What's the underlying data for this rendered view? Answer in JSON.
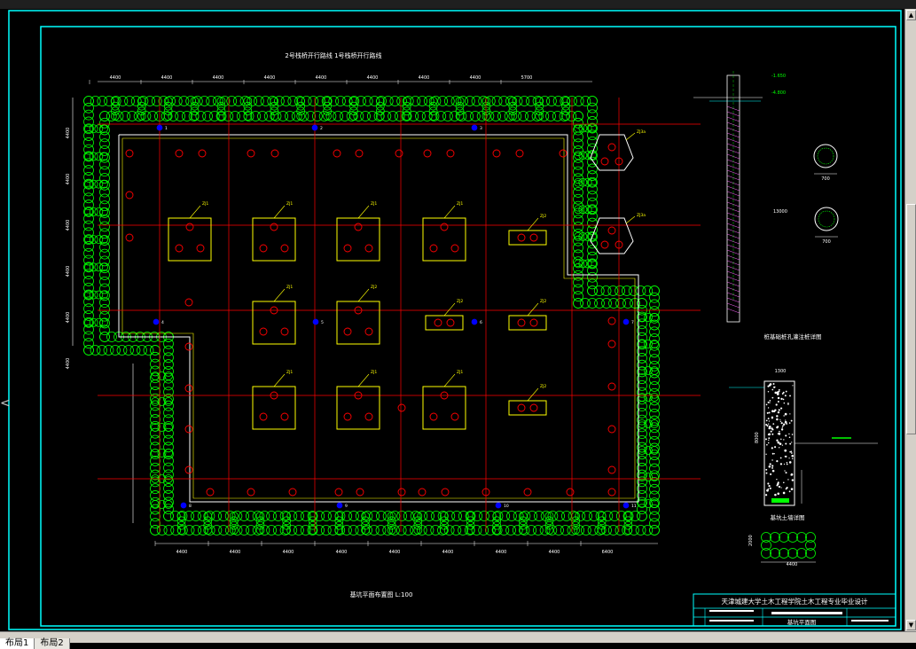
{
  "colors": {
    "background": "#000000",
    "frame": "#00ffff",
    "pile": "#00ff00",
    "wall": "#ffffff",
    "axis": "#ff0000",
    "cap": "#ffff00",
    "dim": "#ffffff"
  },
  "drawing": {
    "top_note": "2号栈桥开行路线 1号栈桥开行路线",
    "plan_title": "基坑平面布置图 L:100",
    "pile_detail_title": "桩基础桩孔灌注桩详图",
    "wall_detail_title": "基坑土墙详图",
    "top_dims": [
      "4400",
      "4400",
      "4400",
      "4400",
      "4400",
      "4400",
      "4400",
      "4400",
      "5700"
    ],
    "bottom_dims": [
      "4400",
      "4400",
      "4400",
      "4400",
      "4400",
      "4400",
      "4400",
      "4400",
      "6400"
    ],
    "left_dims": [
      "4400",
      "4400",
      "4400",
      "4400",
      "4400",
      "4400"
    ],
    "cap_labels": [
      "ZJ1",
      "ZJ1",
      "ZJ1",
      "ZJ2",
      "ZJ1",
      "ZJ1",
      "ZJ2",
      "ZJ2",
      "ZJ1",
      "ZJ1",
      "ZJ1",
      "ZJ2"
    ],
    "tower_labels": [
      "ZJ3a",
      "ZJ3a"
    ],
    "axis_labels": [
      "1",
      "2",
      "3",
      "4",
      "5",
      "6",
      "7",
      "8",
      "9",
      "10",
      "11"
    ],
    "section_dims": [
      "700",
      "700",
      "1300",
      "2000",
      "4400"
    ],
    "depth_labels": [
      "-1.650",
      "-4.800",
      "13000",
      "8000"
    ]
  },
  "title_block": {
    "school": "天津城建大学土木工程学院土木工程专业毕业设计",
    "sheet_name": "基坑平面图"
  },
  "layout_tabs": [
    "布局1",
    "布局2"
  ],
  "left_marker": "<"
}
